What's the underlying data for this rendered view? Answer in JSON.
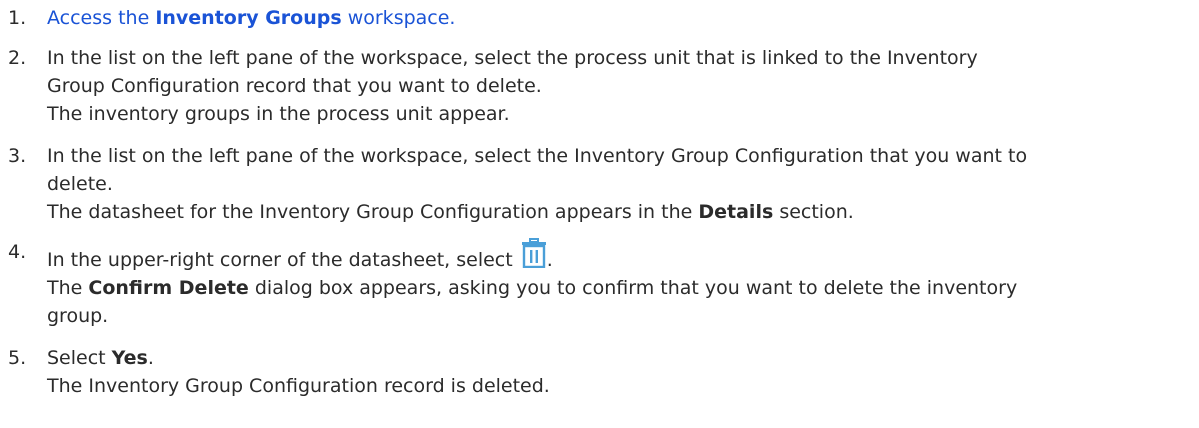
{
  "steps": [
    {
      "num": "1.",
      "pre": "Access the ",
      "link_bold": "Inventory Groups",
      "post": " workspace."
    },
    {
      "num": "2.",
      "line1": "In the list on the left pane of the workspace, select the process unit that is linked to the Inventory",
      "line2": "Group Configuration record that you want to delete.",
      "result": "The inventory groups in the process unit appear."
    },
    {
      "num": "3.",
      "line1": "In the list on the left pane of the workspace, select the Inventory Group Configuration that you want to",
      "line2": "delete.",
      "result_pre": "The datasheet for the Inventory Group Configuration appears in the ",
      "result_bold": "Details",
      "result_post": " section."
    },
    {
      "num": "4.",
      "pre": "In the upper-right corner of the datasheet, select ",
      "post": ".",
      "result_line1_pre": "The ",
      "result_line1_bold": "Confirm Delete",
      "result_line1_post": " dialog box appears, asking you to confirm that you want to delete the inventory",
      "result_line2": "group."
    },
    {
      "num": "5.",
      "pre": "Select ",
      "bold": "Yes",
      "post": ".",
      "result": "The Inventory Group Configuration record is deleted."
    }
  ],
  "icons": {
    "delete": "trash-icon"
  },
  "colors": {
    "link": "#1a53d6",
    "icon": "#4a9fd8",
    "text": "#2b2b2b"
  }
}
